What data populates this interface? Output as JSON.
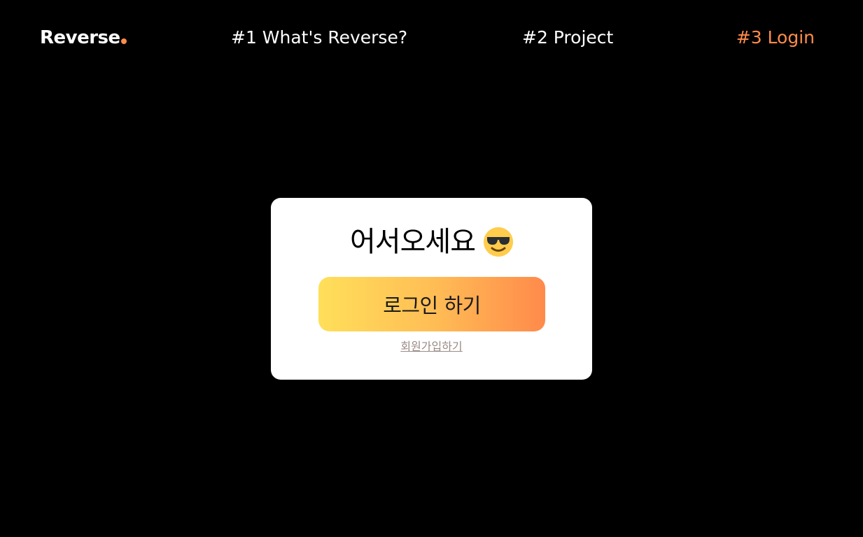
{
  "nav": {
    "logo_text": "Reverse",
    "links": [
      {
        "label": "#1 What's Reverse?"
      },
      {
        "label": "#2 Project"
      },
      {
        "label": "#3 Login",
        "active": true
      }
    ]
  },
  "login_card": {
    "title": "어서오세요",
    "title_emoji": "smiling-face-with-sunglasses-icon",
    "login_button_label": "로그인 하기",
    "signup_link_label": "회원가입하기"
  },
  "colors": {
    "background": "#000000",
    "accent": "#ff8c4b",
    "card": "#ffffff",
    "button_gradient_start": "#ffdf5a",
    "button_gradient_end": "#ff8a4b"
  }
}
